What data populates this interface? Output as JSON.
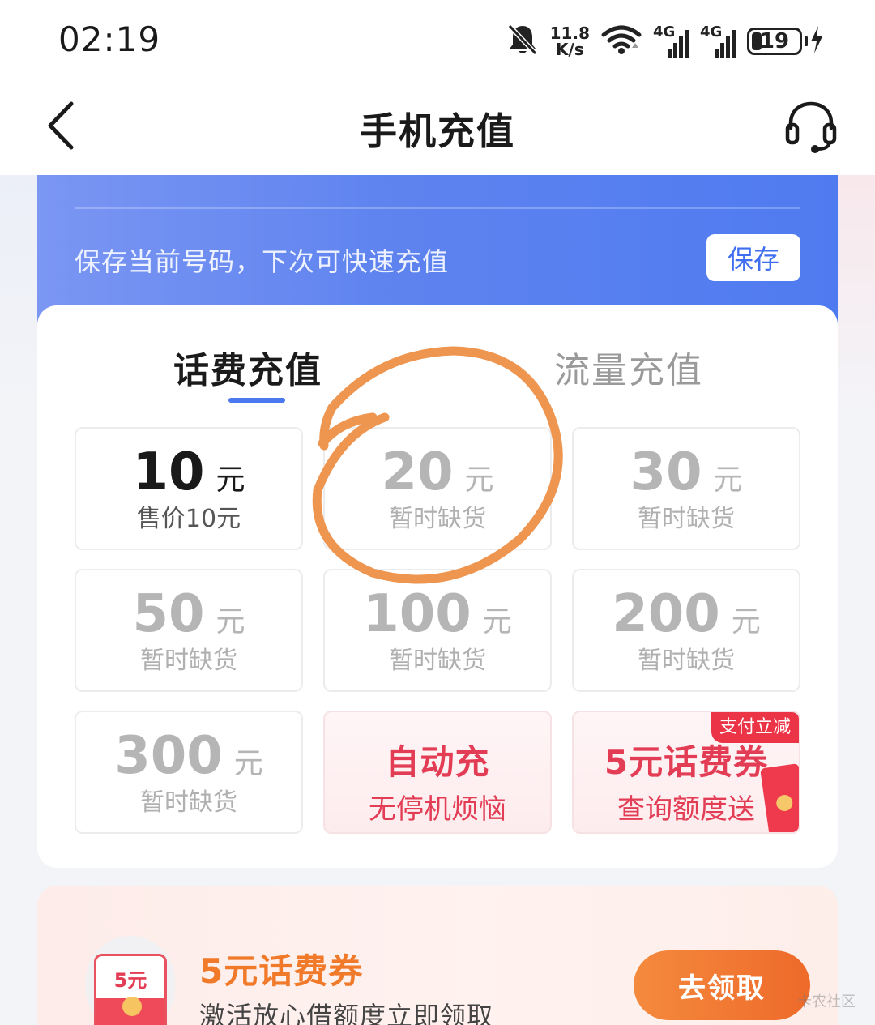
{
  "status_bar": {
    "time": "02:19",
    "net_speed_value": "11.8",
    "net_speed_unit": "K/s",
    "signal1_label": "4G",
    "signal2_label": "4G",
    "battery_level": "19",
    "icons": [
      "mute-bell-icon",
      "wifi-icon",
      "signal-4g-icon",
      "signal-4g-icon",
      "battery-icon",
      "charging-icon"
    ]
  },
  "header": {
    "title": "手机充值",
    "icons": [
      "back-arrow-icon",
      "headset-icon"
    ]
  },
  "save_bar": {
    "hint": "保存当前号码，下次可快速充值",
    "save_label": "保存"
  },
  "tabs": [
    {
      "label": "话费充值",
      "active": true
    },
    {
      "label": "流量充值",
      "active": false
    }
  ],
  "options": [
    {
      "amount": "10",
      "unit": "元",
      "sub": "售价10元",
      "status": "available"
    },
    {
      "amount": "20",
      "unit": "元",
      "sub": "暂时缺货",
      "status": "soldout"
    },
    {
      "amount": "30",
      "unit": "元",
      "sub": "暂时缺货",
      "status": "soldout"
    },
    {
      "amount": "50",
      "unit": "元",
      "sub": "暂时缺货",
      "status": "soldout"
    },
    {
      "amount": "100",
      "unit": "元",
      "sub": "暂时缺货",
      "status": "soldout"
    },
    {
      "amount": "200",
      "unit": "元",
      "sub": "暂时缺货",
      "status": "soldout"
    },
    {
      "amount": "300",
      "unit": "元",
      "sub": "暂时缺货",
      "status": "soldout"
    }
  ],
  "auto_recharge": {
    "title": "自动充",
    "sub": "无停机烦恼"
  },
  "promo": {
    "badge": "支付立减",
    "title": "5元话费券",
    "sub": "查询额度送"
  },
  "coupon_banner": {
    "icon_value": "5元",
    "title": "5元话费券",
    "desc": "激活放心借额度立即领取",
    "button": "去领取"
  },
  "watermark": "卡农社区",
  "colors": {
    "accent_blue": "#4a78ee",
    "promo_red": "#e23d55",
    "orange": "#f07a2a",
    "annotation": "#ee9550"
  }
}
